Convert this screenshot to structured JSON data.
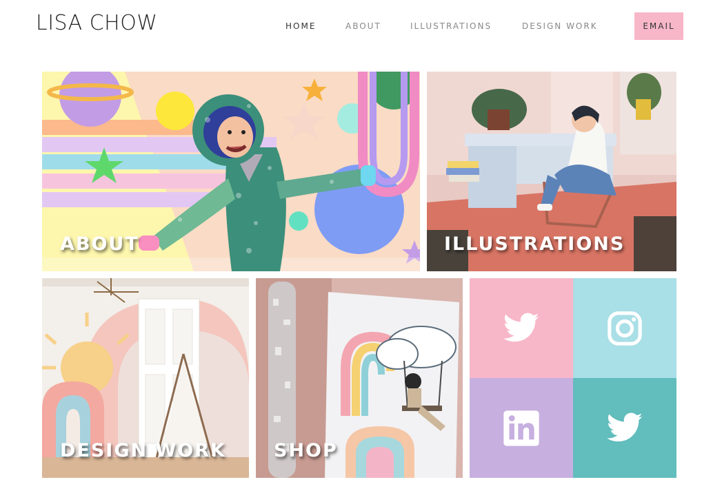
{
  "header": {
    "logo": "LISA CHOW",
    "nav": [
      {
        "label": "HOME",
        "active": true
      },
      {
        "label": "ABOUT",
        "active": false
      },
      {
        "label": "ILLUSTRATIONS",
        "active": false
      },
      {
        "label": "DESIGN WORK",
        "active": false
      }
    ],
    "email_label": "EMAIL"
  },
  "tiles": {
    "about": "ABOUT",
    "illustrations": "ILLUSTRATIONS",
    "design_work": "DESIGN WORK",
    "shop": "SHOP"
  },
  "social": [
    {
      "icon": "twitter-icon",
      "color": "#f7b7c9"
    },
    {
      "icon": "instagram-icon",
      "color": "#a9dfe6"
    },
    {
      "icon": "linkedin-icon",
      "color": "#c7afe0"
    },
    {
      "icon": "twitter-icon",
      "color": "#62bdbd"
    }
  ],
  "colors": {
    "accent": "#f7b7c8",
    "nav_text": "#888888",
    "nav_active": "#333333"
  }
}
